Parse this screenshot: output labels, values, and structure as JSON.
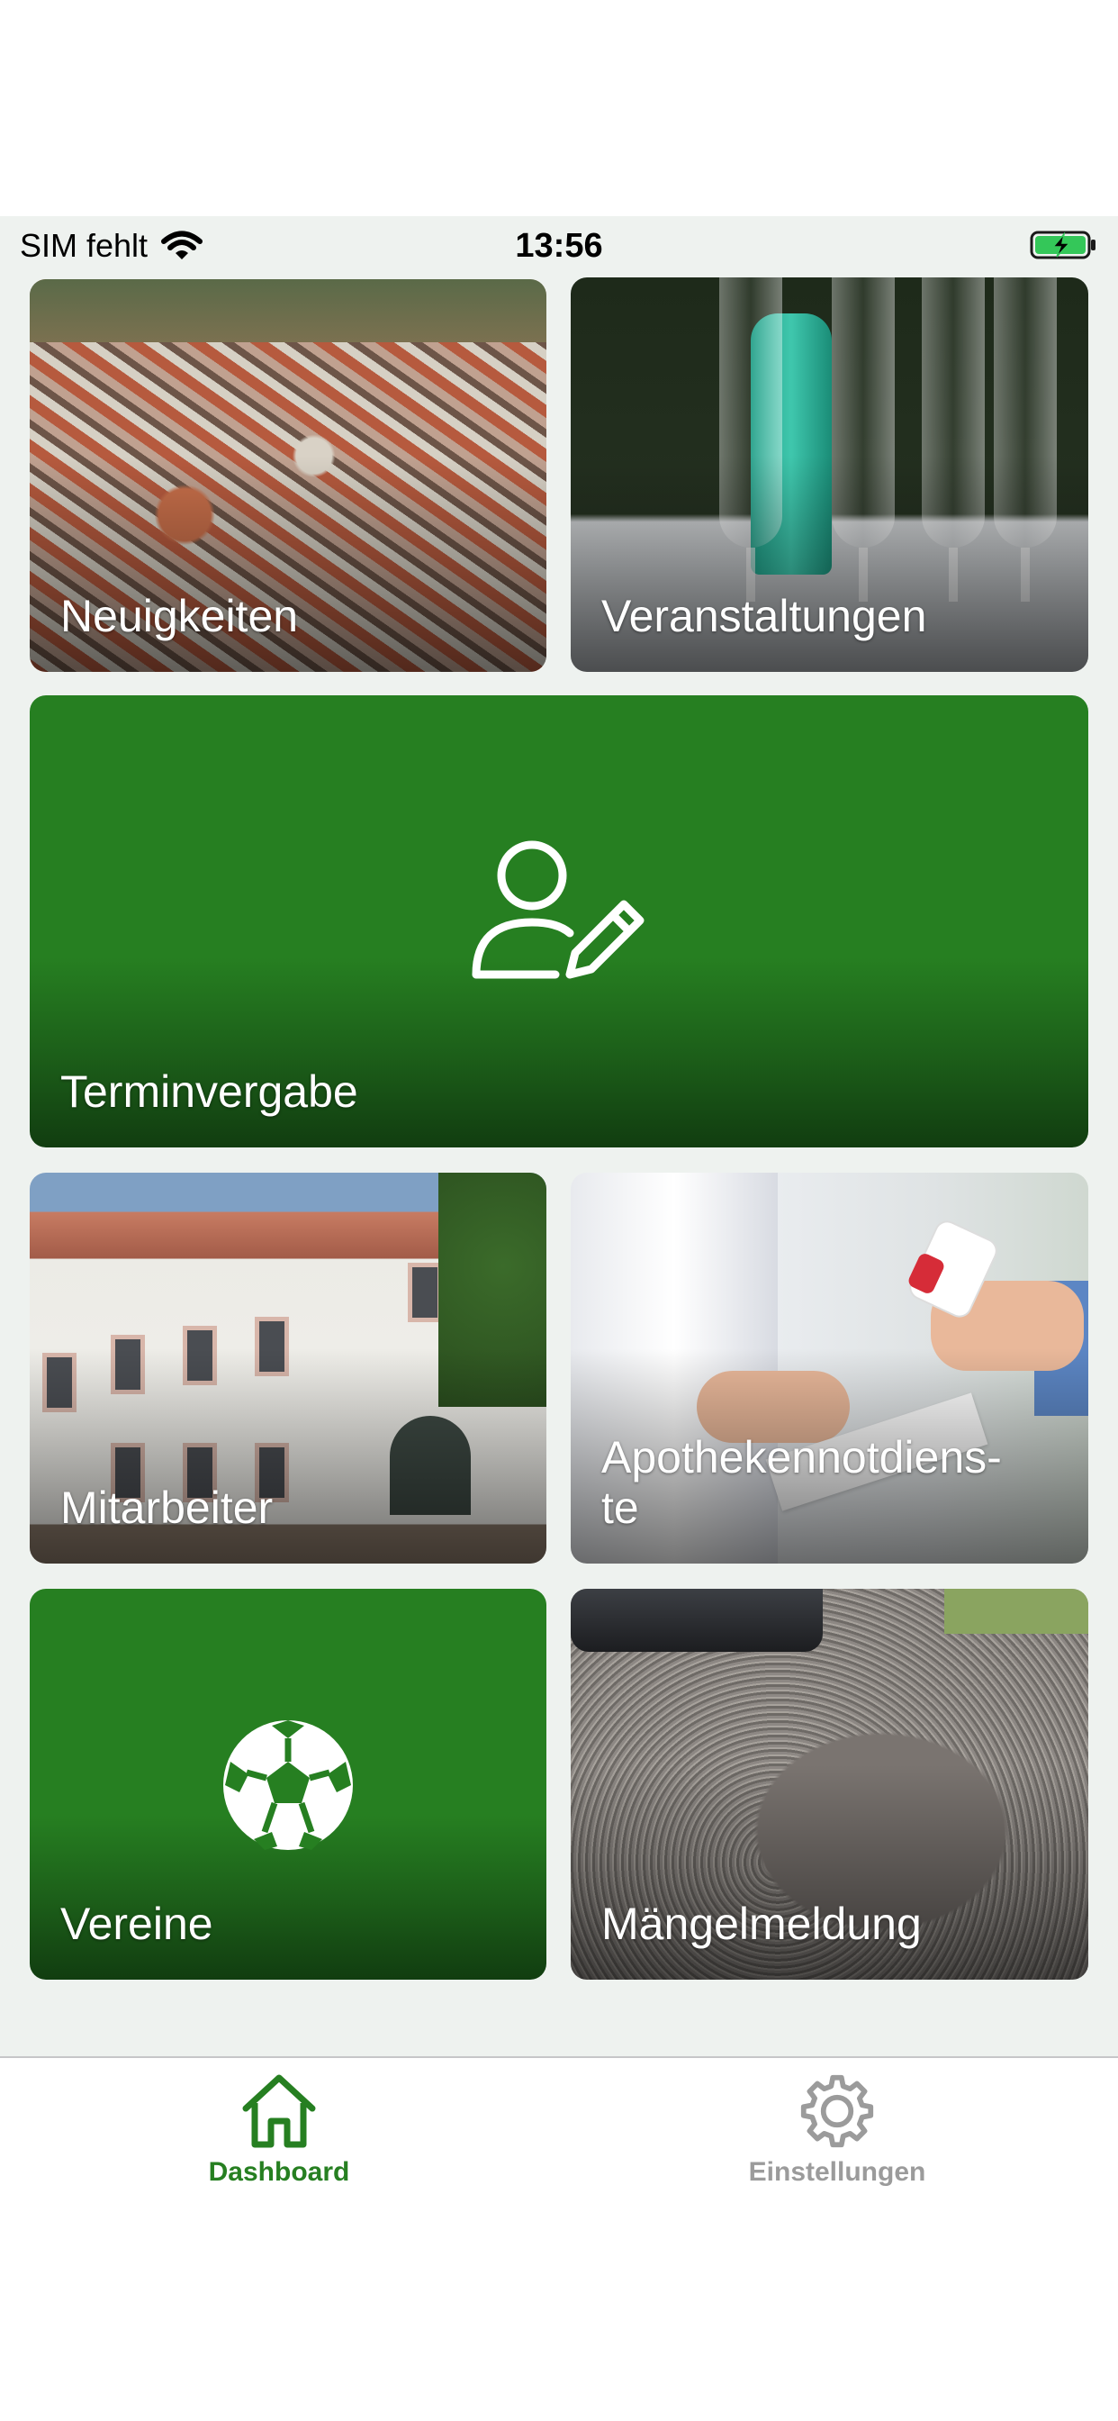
{
  "status_bar": {
    "carrier": "SIM fehlt",
    "time": "13:56",
    "battery_state": "charging"
  },
  "tiles": [
    {
      "label": "Neuigkeiten",
      "style": "photo",
      "photo": "aerial town view"
    },
    {
      "label": "Veranstaltungen",
      "style": "photo",
      "photo": "champagne glasses"
    },
    {
      "label": "Terminvergabe",
      "style": "icon",
      "icon": "user-edit-icon",
      "color": "#267f21"
    },
    {
      "label": "Mitarbeiter",
      "style": "photo",
      "photo": "town hall building"
    },
    {
      "label": "Apothekennotdiens-\nte",
      "style": "photo",
      "photo": "pharmacy"
    },
    {
      "label": "Vereine",
      "style": "icon",
      "icon": "soccer-ball-icon",
      "color": "#267f21"
    },
    {
      "label": "Mängelmeldung",
      "style": "photo",
      "photo": "pothole in road"
    }
  ],
  "tab_bar": {
    "active": "Dashboard",
    "items": [
      {
        "label": "Dashboard",
        "icon": "home-icon",
        "color": "#267f21"
      },
      {
        "label": "Einstellungen",
        "icon": "gear-icon",
        "color": "#9b9b9b"
      }
    ]
  }
}
